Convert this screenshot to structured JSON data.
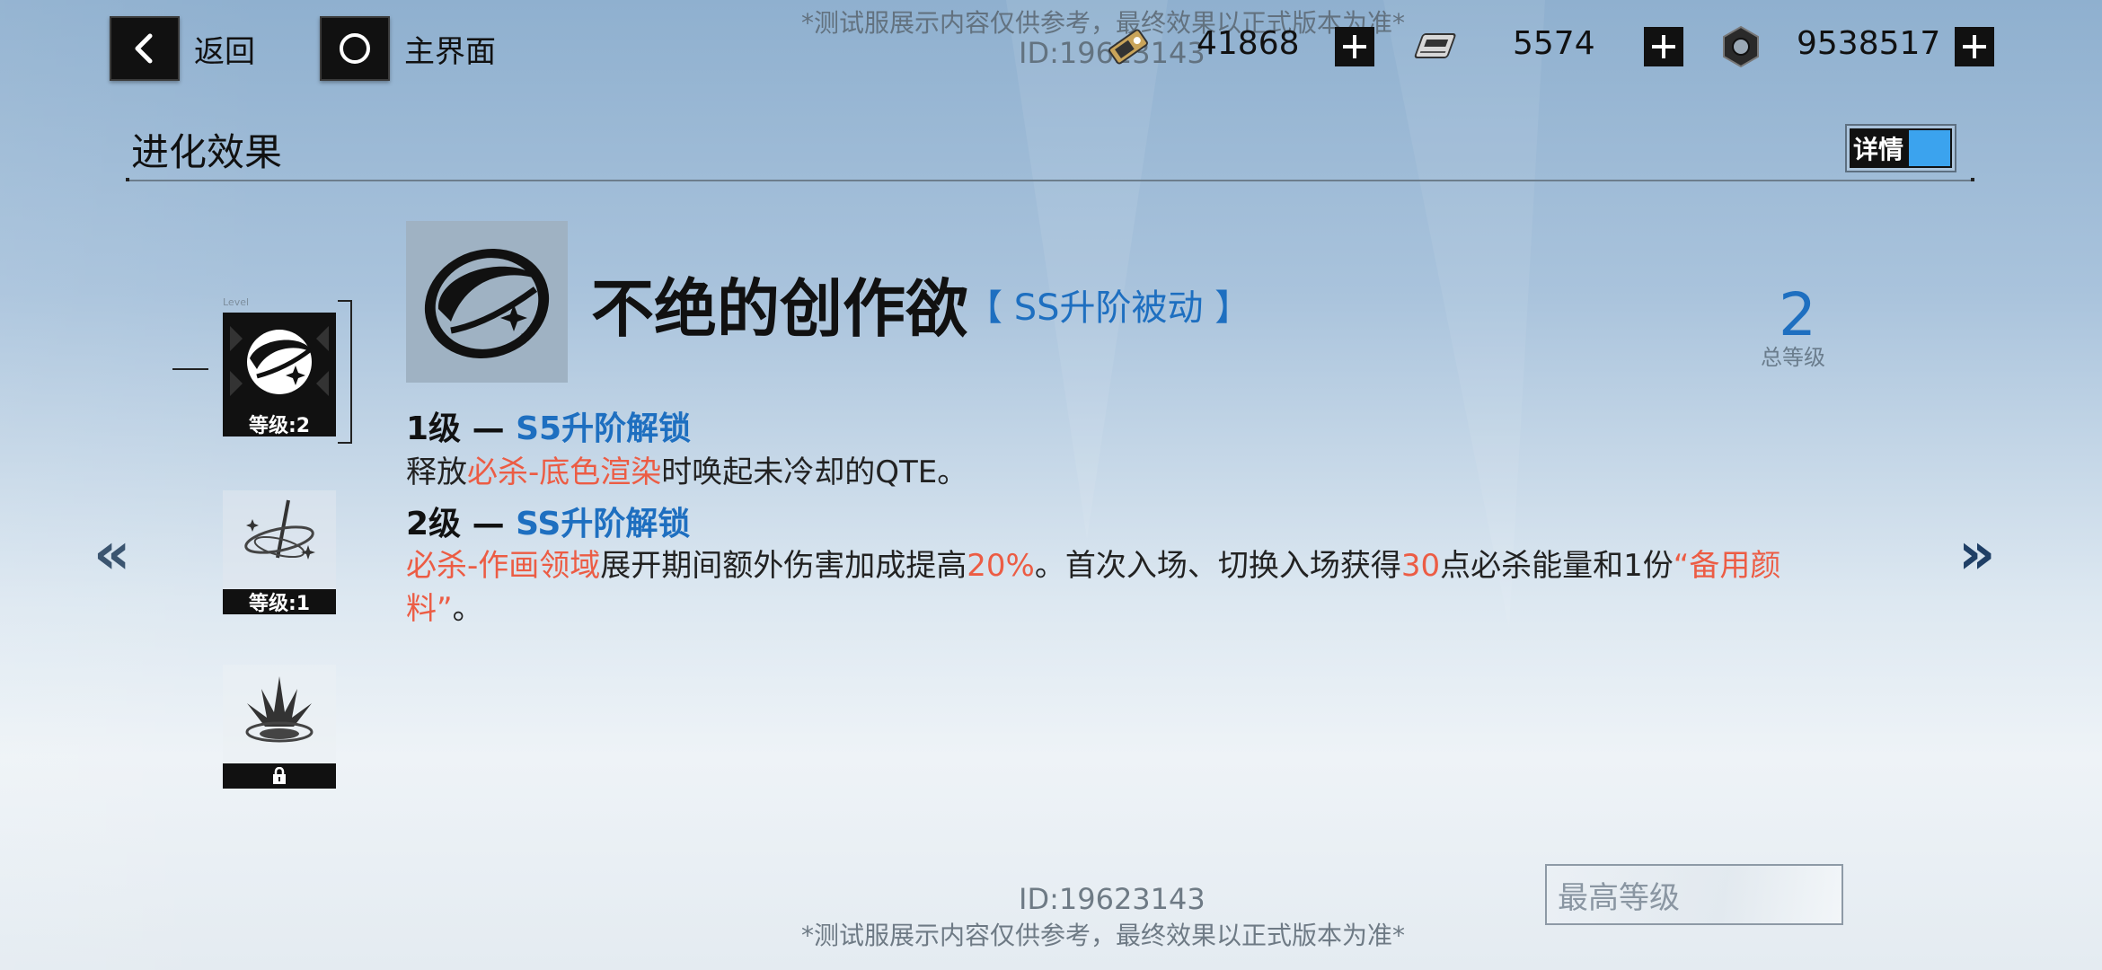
{
  "top_bar": {
    "back_label": "返回",
    "home_label": "主界面",
    "resources": [
      {
        "icon": "ticket-icon",
        "value": "41868"
      },
      {
        "icon": "chip-icon",
        "value": "5574"
      },
      {
        "icon": "hex-nut-icon",
        "value": "9538517"
      }
    ]
  },
  "watermark": {
    "notice": "*测试服展示内容仅供参考，最终效果以正式版本为准*",
    "id": "ID:19623143"
  },
  "header": {
    "title": "进化效果",
    "detail_toggle_label": "详情"
  },
  "skill_list": [
    {
      "icon": "slash-orb-icon",
      "label": "等级:2",
      "selected": true
    },
    {
      "icon": "pen-orbit-icon",
      "label": "等级:1",
      "selected": false
    },
    {
      "icon": "burst-icon",
      "label": "lock-icon",
      "locked": true
    }
  ],
  "card_level_tag": "Level",
  "skill": {
    "name": "不绝的创作欲",
    "type": "【 SS升阶被动 】",
    "total_level": "2",
    "total_level_label": "总等级",
    "levels": [
      {
        "prefix": "1级 — ",
        "unlock": "S5升阶解锁",
        "desc": [
          {
            "t": "释放",
            "hl": false
          },
          {
            "t": "必杀-底色渲染",
            "hl": true
          },
          {
            "t": "时唤起未冷却的QTE。",
            "hl": false
          }
        ]
      },
      {
        "prefix": "2级 — ",
        "unlock": "SS升阶解锁",
        "desc": [
          {
            "t": "必杀-作画领域",
            "hl": true
          },
          {
            "t": "展开期间额外伤害加成提高",
            "hl": false
          },
          {
            "t": "20%",
            "hl": true
          },
          {
            "t": "。首次入场、切换入场获得",
            "hl": false
          },
          {
            "t": "30",
            "hl": true
          },
          {
            "t": "点必杀能量和1份",
            "hl": false
          },
          {
            "t": "“备用颜料”",
            "hl": true
          },
          {
            "t": "。",
            "hl": false
          }
        ]
      }
    ]
  },
  "max_level_label": "最高等级",
  "colors": {
    "accent_blue": "#1e6fc0",
    "highlight_red": "#ec5c44",
    "toggle_blue": "#3ba3ee"
  }
}
